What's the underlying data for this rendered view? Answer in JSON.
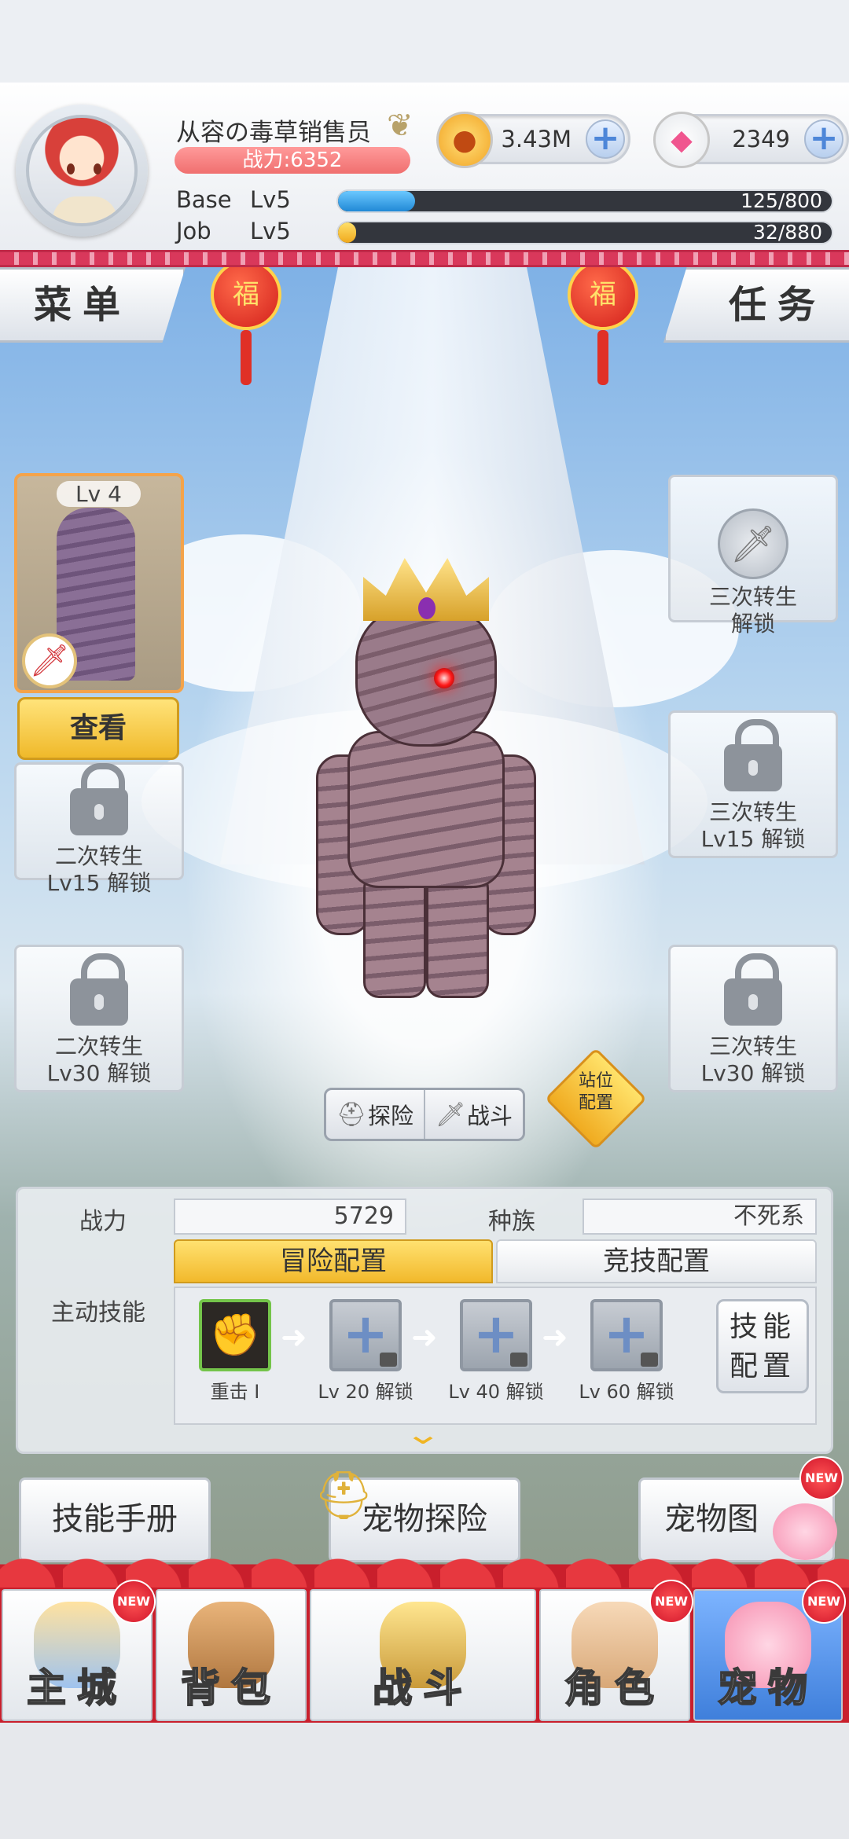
{
  "player": {
    "name": "从容の毒草销售员",
    "power_label": "战力:6352",
    "base_label": "Base",
    "base_level": "Lv5",
    "base_exp": "125/800",
    "base_progress": 0.156,
    "job_label": "Job",
    "job_level": "Lv5",
    "job_exp": "32/880",
    "job_progress": 0.036
  },
  "currency": {
    "gold": "3.43M",
    "gems": "2349",
    "plus": "+"
  },
  "tabs": {
    "menu": "菜单",
    "task": "任务"
  },
  "lantern_char": "福",
  "pet_card": {
    "level": "Lv 4",
    "view_button": "查看"
  },
  "slots": {
    "left_2": [
      "二次转生",
      "Lv15 解锁"
    ],
    "left_3": [
      "二次转生",
      "Lv30 解锁"
    ],
    "right_1": [
      "三次转生",
      "解锁"
    ],
    "right_2": [
      "三次转生",
      "Lv15 解锁"
    ],
    "right_3": [
      "三次转生",
      "Lv30 解锁"
    ]
  },
  "modes": {
    "explore": "探险",
    "battle": "战斗"
  },
  "formation": [
    "站位",
    "配置"
  ],
  "info": {
    "power_label": "战力",
    "power_value": "5729",
    "race_label": "种族",
    "race_value": "不死系",
    "skills_label": "主动技能",
    "tab_adventure": "冒险配置",
    "tab_arena": "竞技配置",
    "skill_config": [
      "技能",
      "配置"
    ],
    "skills": [
      {
        "caption": "重击 Ⅰ"
      },
      {
        "caption": "Lv 20 解锁"
      },
      {
        "caption": "Lv 40 解锁"
      },
      {
        "caption": "Lv 60 解锁"
      }
    ]
  },
  "lower_buttons": {
    "skill_manual": "技能手册",
    "pet_explore": "宠物探险",
    "pet_atlas": "宠物图"
  },
  "badge_text": "NEW",
  "nav": [
    {
      "label": "主城",
      "new": true
    },
    {
      "label": "背包",
      "new": false
    },
    {
      "label": "战斗",
      "new": false
    },
    {
      "label": "角色",
      "new": true
    },
    {
      "label": "宠物",
      "new": true
    }
  ],
  "colors": {
    "accent_gold": "#f0b92a",
    "accent_red": "#c91f2c",
    "base_bar": "#3aa3e8",
    "job_bar": "#f5c531",
    "active_nav": "#3f7fdb"
  }
}
